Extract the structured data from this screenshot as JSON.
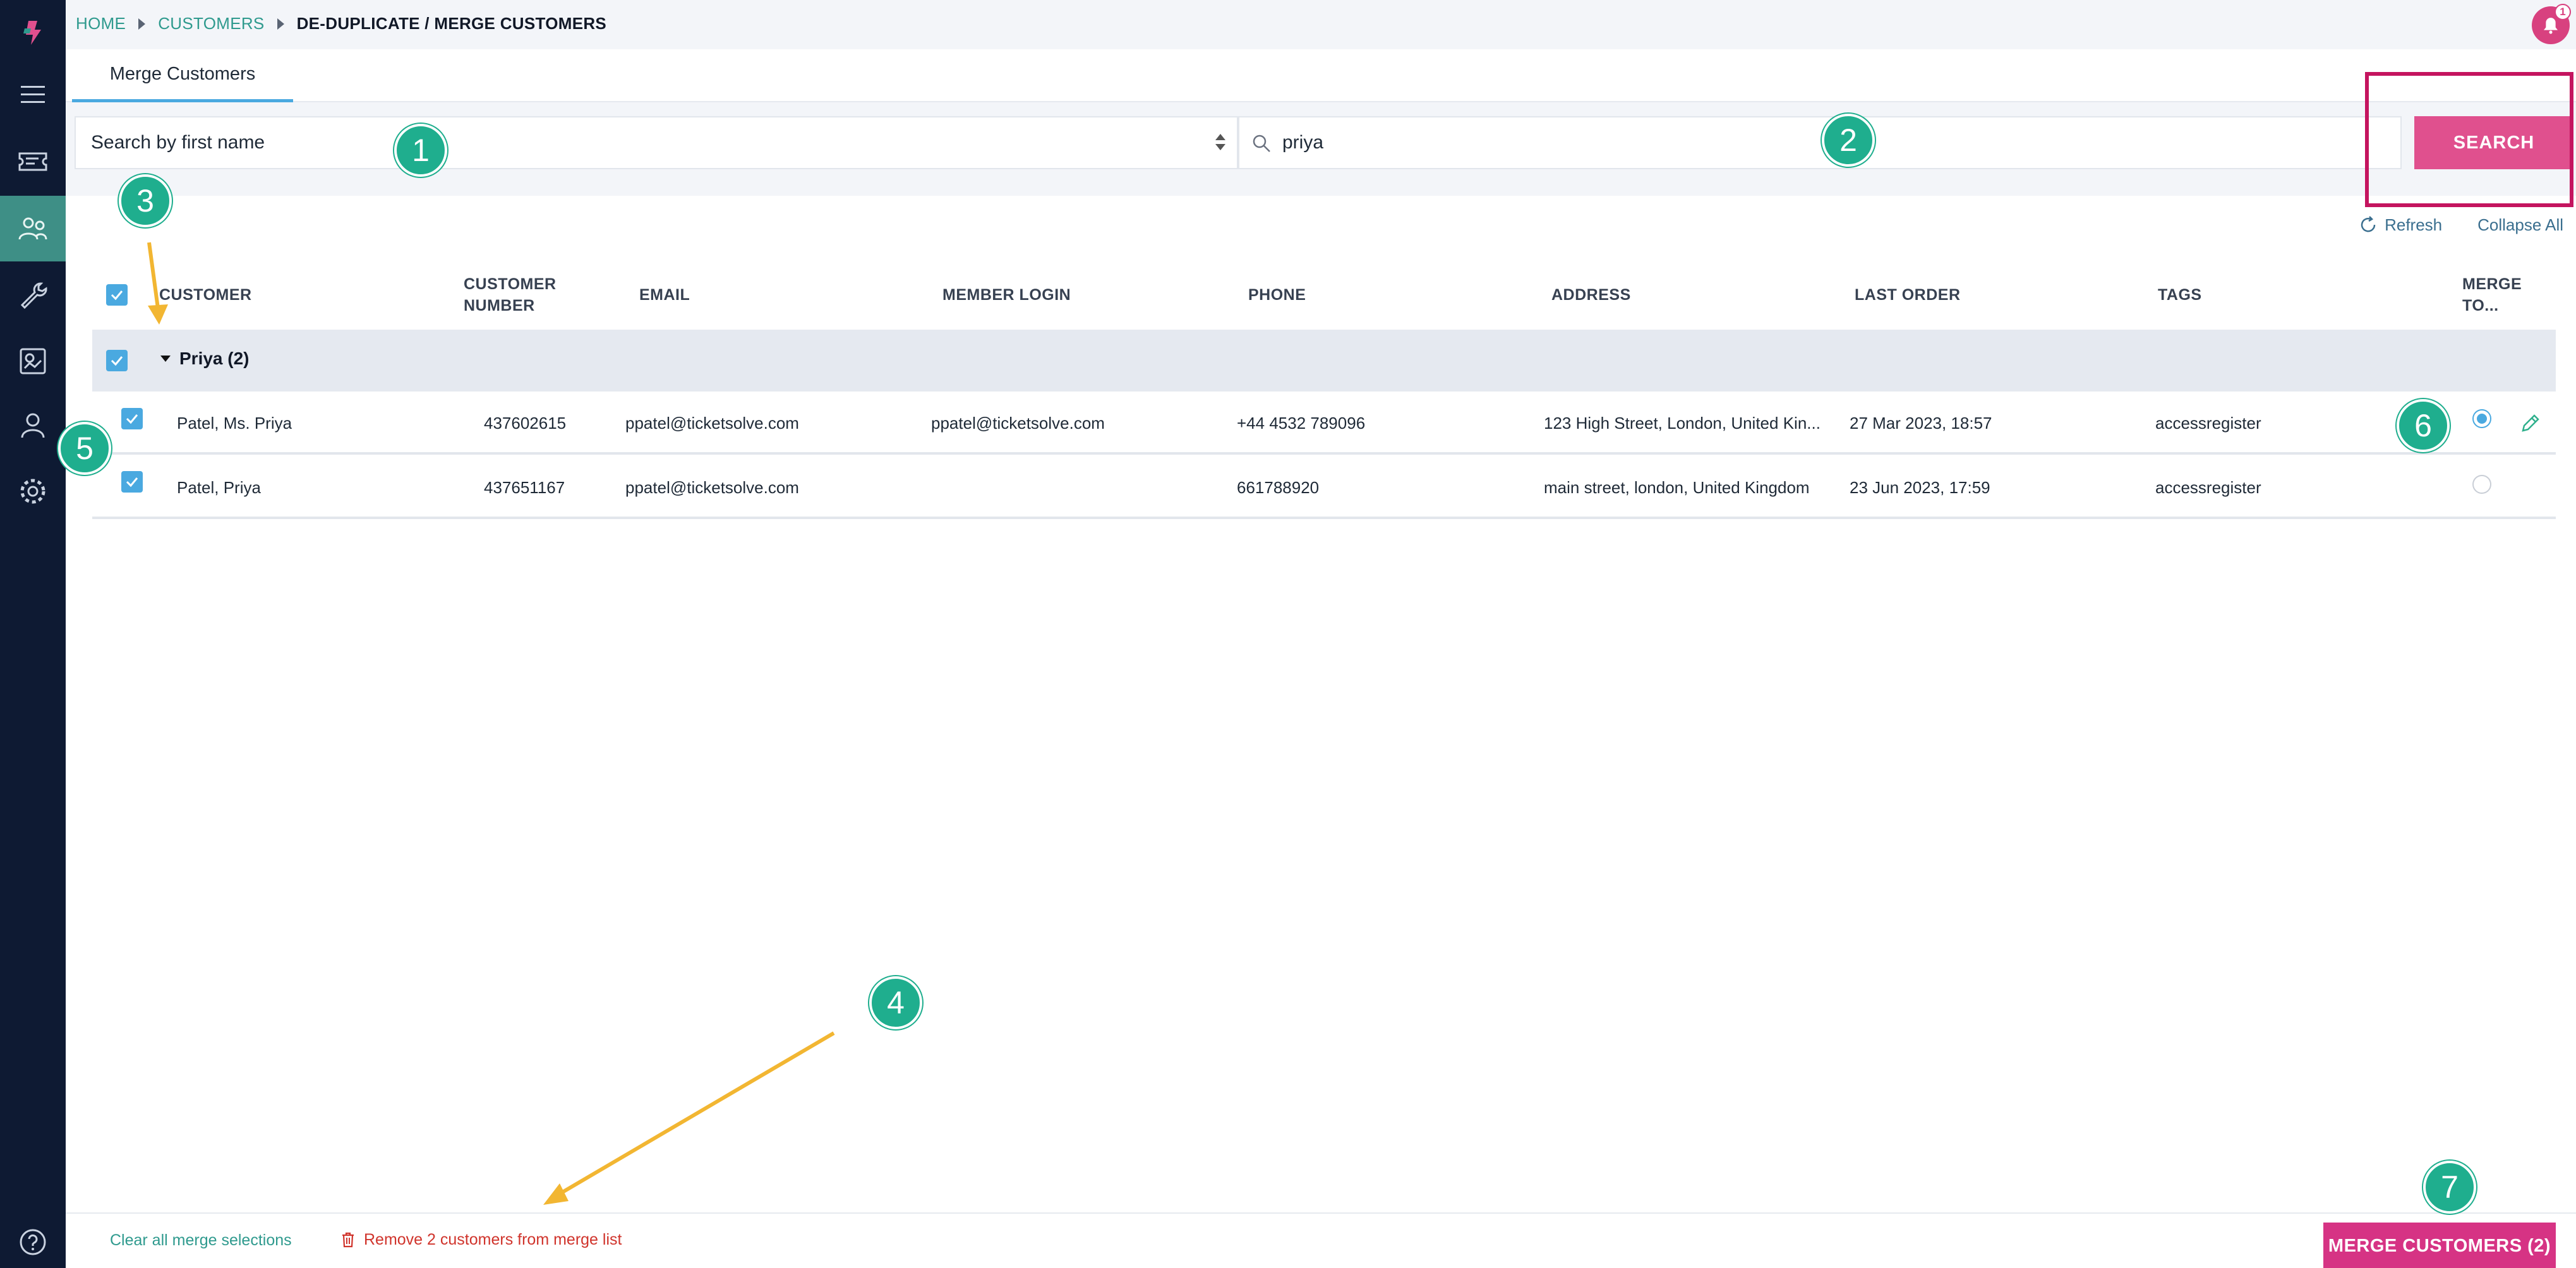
{
  "breadcrumb": {
    "home": "HOME",
    "customers": "CUSTOMERS",
    "current": "DE-DUPLICATE / MERGE CUSTOMERS"
  },
  "notifications": {
    "count": "1"
  },
  "tabs": {
    "merge": "Merge Customers"
  },
  "search": {
    "field_select": "Search by first name",
    "query": "priya",
    "button": "SEARCH"
  },
  "actions": {
    "refresh": "Refresh",
    "collapse": "Collapse All"
  },
  "table": {
    "headers": {
      "customer": "CUSTOMER",
      "customer_number": "CUSTOMER NUMBER",
      "email": "EMAIL",
      "member_login": "MEMBER LOGIN",
      "phone": "PHONE",
      "address": "ADDRESS",
      "last_order": "LAST ORDER",
      "tags": "TAGS",
      "merge_to": "MERGE TO..."
    },
    "group": {
      "label": "Priya (2)"
    },
    "rows": [
      {
        "customer": "Patel, Ms. Priya",
        "customer_number": "437602615",
        "email": "ppatel@ticketsolve.com",
        "member_login": "ppatel@ticketsolve.com",
        "phone": "+44 4532 789096",
        "address": "123 High Street, London, United Kin...",
        "last_order": "27 Mar 2023, 18:57",
        "tags": "accessregister",
        "merge_to": true
      },
      {
        "customer": "Patel, Priya",
        "customer_number": "437651167",
        "email": "ppatel@ticketsolve.com",
        "member_login": "",
        "phone": "661788920",
        "address": "main street, london, United Kingdom",
        "last_order": "23 Jun 2023, 17:59",
        "tags": "accessregister",
        "merge_to": false
      }
    ]
  },
  "footer": {
    "clear": "Clear all merge selections",
    "remove": "Remove 2 customers from merge list",
    "merge": "MERGE CUSTOMERS (2)"
  },
  "callouts": [
    "1",
    "2",
    "3",
    "4",
    "5",
    "6",
    "7"
  ],
  "colors": {
    "sidebar": "#0e1a33",
    "accent_teal": "#2f9a8e",
    "primary_pink": "#e0508e",
    "checkbox_blue": "#4aa9e0",
    "callout_green": "#1fae8e",
    "annotation_arrow": "#f2b632",
    "highlight_box": "#c4145f"
  },
  "icons": {
    "sidebar": [
      "logo-icon",
      "menu-icon",
      "ticket-icon",
      "customers-icon",
      "wrench-icon",
      "reports-icon",
      "user-icon",
      "settings-icon",
      "help-icon"
    ]
  }
}
